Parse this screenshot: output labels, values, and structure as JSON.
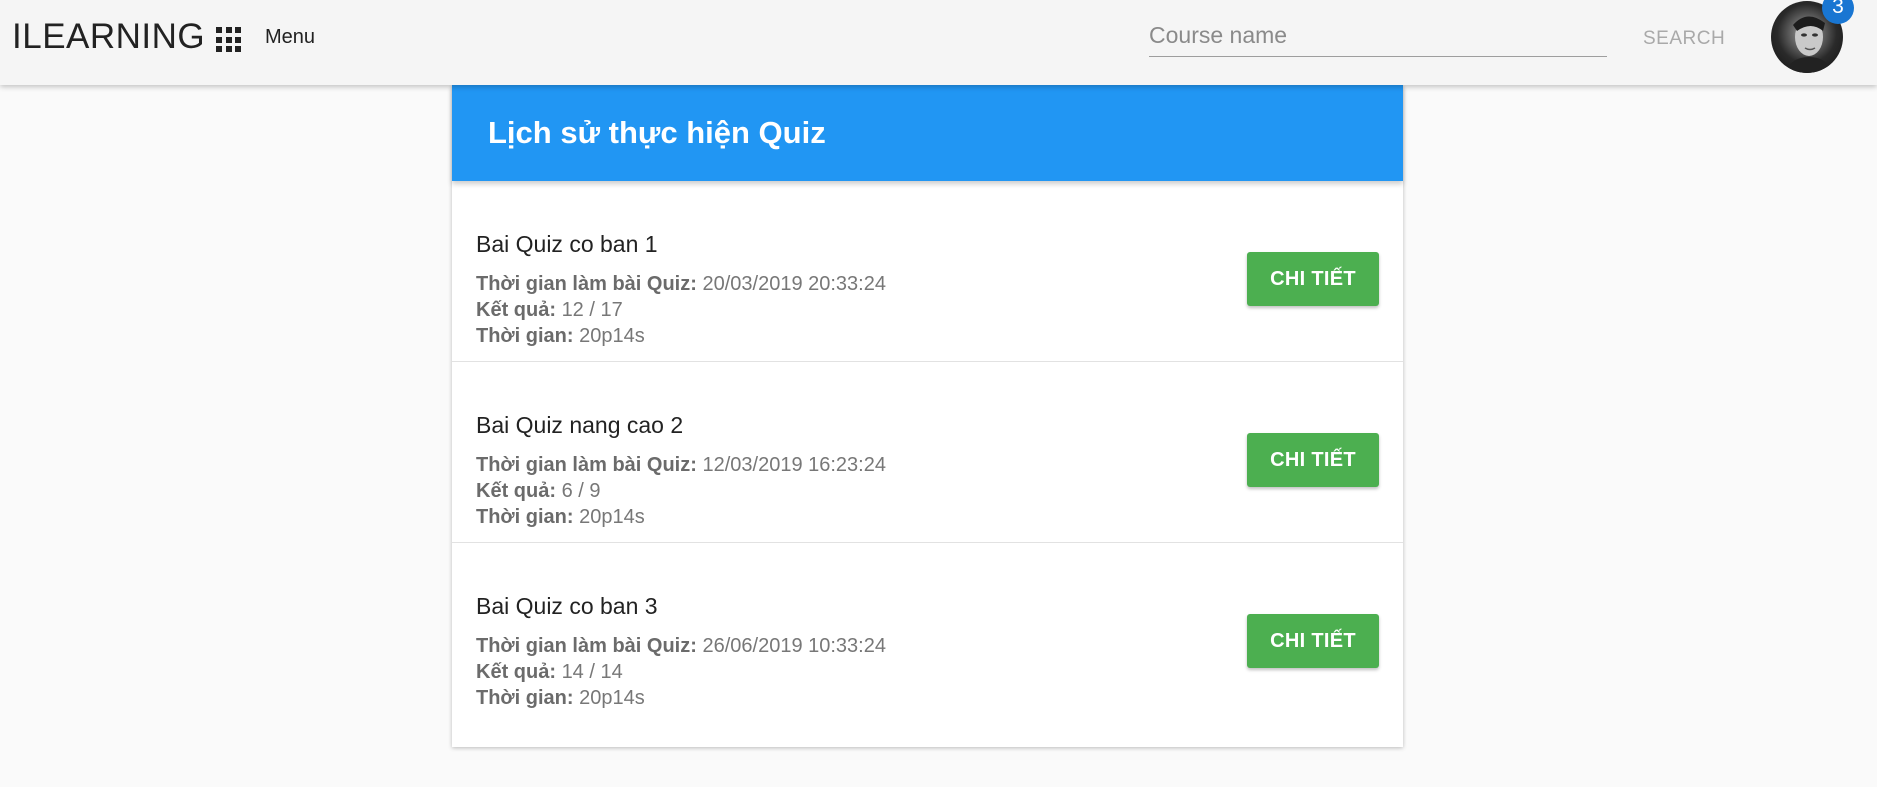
{
  "app": {
    "brand": "ILEARNING",
    "menu_label": "Menu",
    "search": {
      "placeholder": "Course name",
      "value": "",
      "button_label": "SEARCH"
    },
    "notifications_count": "3"
  },
  "page": {
    "title": "Lịch sử thực hiện Quiz",
    "labels": {
      "time_taken_at": "Thời gian làm bài Quiz:",
      "result": "Kết quả:",
      "duration": "Thời gian:"
    },
    "detail_button_label": "CHI TIẾT",
    "quizzes": [
      {
        "name": "Bai Quiz co ban 1",
        "taken_at": "20/03/2019 20:33:24",
        "result": "12 / 17",
        "duration": "20p14s"
      },
      {
        "name": "Bai Quiz nang cao 2",
        "taken_at": "12/03/2019 16:23:24",
        "result": "6 / 9",
        "duration": "20p14s"
      },
      {
        "name": "Bai Quiz co ban 3",
        "taken_at": "26/06/2019 10:33:24",
        "result": "14 / 14",
        "duration": "20p14s"
      }
    ]
  },
  "colors": {
    "header_blue": "#2196f3",
    "button_green": "#4caf50",
    "badge_blue": "#1976d2"
  },
  "icons": {
    "apps": "apps-grid-icon",
    "avatar": "user-avatar"
  }
}
